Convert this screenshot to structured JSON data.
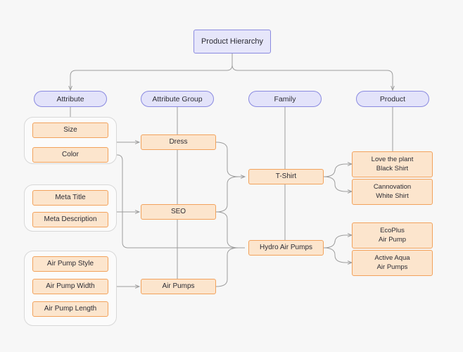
{
  "diagram": {
    "title": "Product Hierarchy",
    "colors": {
      "background": "#f7f7f7",
      "node_purple_fill": "#e6e6fa",
      "node_purple_border": "#8a8ae0",
      "node_orange_fill": "#fce5cd",
      "node_orange_border": "#f2a25c",
      "group_border": "#d8d8d8",
      "edge": "#9e9e9e"
    },
    "root": {
      "label": "Product Hierarchy"
    },
    "columns": [
      {
        "id": "attribute",
        "label": "Attribute"
      },
      {
        "id": "attribute_group",
        "label": "Attribute Group"
      },
      {
        "id": "family",
        "label": "Family"
      },
      {
        "id": "product",
        "label": "Product"
      }
    ],
    "attribute_groups": [
      {
        "id": "grp1",
        "items": [
          {
            "label": "Size"
          },
          {
            "label": "Color"
          }
        ]
      },
      {
        "id": "grp2",
        "items": [
          {
            "label": "Meta Title"
          },
          {
            "label": "Meta Description"
          }
        ]
      },
      {
        "id": "grp3",
        "items": [
          {
            "label": "Air Pump Style"
          },
          {
            "label": "Air Pump Width"
          },
          {
            "label": "Air Pump Length"
          }
        ]
      }
    ],
    "attribute_group_nodes": [
      {
        "label": "Dress"
      },
      {
        "label": "SEO"
      },
      {
        "label": "Air Pumps"
      }
    ],
    "family_nodes": [
      {
        "label": "T-Shirt"
      },
      {
        "label": "Hydro Air Pumps"
      }
    ],
    "product_nodes": [
      {
        "line1": "Love the plant",
        "line2": "Black Shirt"
      },
      {
        "line1": "Cannovation",
        "line2": "White Shirt"
      },
      {
        "line1": "EcoPlus",
        "line2": "Air Pump"
      },
      {
        "line1": "Active Aqua",
        "line2": "Air Pumps"
      }
    ]
  }
}
